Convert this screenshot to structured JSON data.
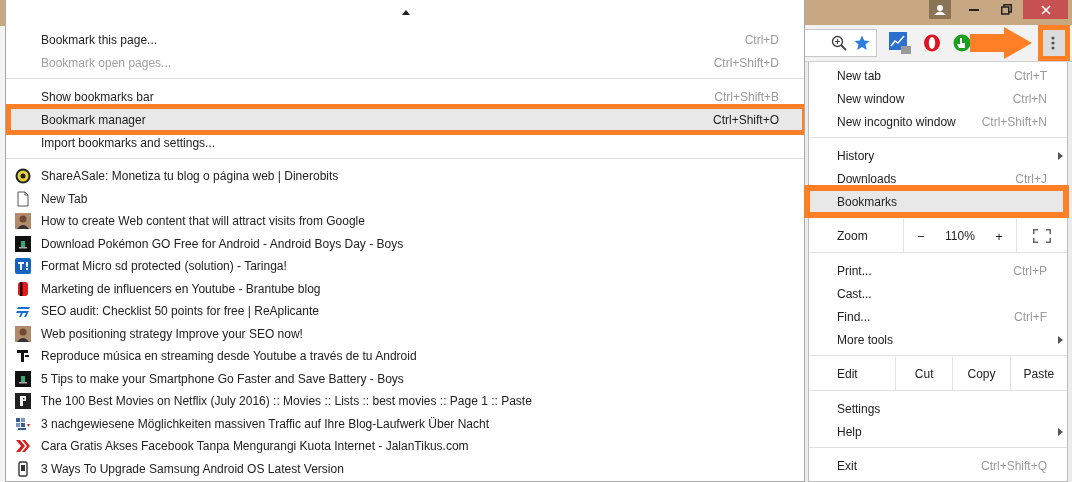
{
  "toolbar": {
    "menu_button": {
      "outlined": true,
      "pointer_arrow": true
    }
  },
  "bookmarks_menu": {
    "sections": [
      [
        {
          "label": "Bookmark this page...",
          "shortcut": "Ctrl+D",
          "disabled": false,
          "selected": false,
          "outlined": false
        },
        {
          "label": "Bookmark open pages...",
          "shortcut": "Ctrl+Shift+D",
          "disabled": true,
          "selected": false,
          "outlined": false
        }
      ],
      [
        {
          "label": "Show bookmarks bar",
          "shortcut": "Ctrl+Shift+B",
          "disabled": false,
          "selected": false,
          "outlined": false
        },
        {
          "label": "Bookmark manager",
          "shortcut": "Ctrl+Shift+O",
          "disabled": false,
          "selected": true,
          "outlined": true
        },
        {
          "label": "Import bookmarks and settings...",
          "disabled": false,
          "selected": false,
          "outlined": false
        }
      ]
    ],
    "bookmarks": [
      {
        "kind": "coin",
        "title": "ShareASale: Monetiza tu blog o página web | Dinerobits"
      },
      {
        "kind": "page",
        "title": "New Tab"
      },
      {
        "kind": "photo",
        "title": "How to create Web content that will attract visits from Google"
      },
      {
        "kind": "dark",
        "title": "Download Pokémon GO Free for Android - Android Boys Day - Boys"
      },
      {
        "kind": "blue-square",
        "title": "Format Micro sd protected (solution) - Taringa!"
      },
      {
        "kind": "red-block",
        "title": "Marketing de influencers en Youtube - Brantube blog"
      },
      {
        "kind": "stripes",
        "title": "SEO audit: Checklist 50 points for free | ReAplicante"
      },
      {
        "kind": "photo",
        "title": "Web positioning strategy Improve your SEO now!"
      },
      {
        "kind": "bars",
        "title": "Reproduce música en streaming desde Youtube a través de tu Android"
      },
      {
        "kind": "dark",
        "title": "5 Tips to make your Smartphone Go Faster and Save Battery - Boys"
      },
      {
        "kind": "black-square",
        "title": "The 100 Best Movies on Netflix (July 2016) :: Movies :: Lists :: best movies :: Page 1 :: Paste"
      },
      {
        "kind": "grid",
        "title": "3 nachgewiesene Möglichkeiten massiven Traffic auf Ihre Blog-Laufwerk Über Nacht"
      },
      {
        "kind": "chevrons",
        "title": "Cara Gratis Akses Facebook Tanpa Mengurangi Kuota Internet - JalanTikus.com"
      },
      {
        "kind": "phone",
        "title": "3 Ways To Upgrade Samsung Android OS Latest Version"
      }
    ]
  },
  "chrome_menu": {
    "sections": [
      [
        {
          "kind": "item",
          "label": "New tab",
          "shortcut": "Ctrl+T",
          "submenu": false,
          "selected": false,
          "outlined": false
        },
        {
          "kind": "item",
          "label": "New window",
          "shortcut": "Ctrl+N",
          "submenu": false,
          "selected": false,
          "outlined": false
        },
        {
          "kind": "item",
          "label": "New incognito window",
          "shortcut": "Ctrl+Shift+N",
          "submenu": false,
          "selected": false,
          "outlined": false
        }
      ],
      [
        {
          "kind": "item",
          "label": "History",
          "submenu": true,
          "selected": false,
          "outlined": false
        },
        {
          "kind": "item",
          "label": "Downloads",
          "shortcut": "Ctrl+J",
          "submenu": false,
          "selected": false,
          "outlined": false
        },
        {
          "kind": "item",
          "label": "Bookmarks",
          "submenu": false,
          "selected": true,
          "outlined": true
        }
      ],
      [
        {
          "kind": "zoom",
          "label": "Zoom",
          "minus": "−",
          "value": "110%",
          "plus": "+",
          "selected": false,
          "outlined": false
        }
      ],
      [
        {
          "kind": "item",
          "label": "Print...",
          "shortcut": "Ctrl+P",
          "submenu": false,
          "selected": false,
          "outlined": false
        },
        {
          "kind": "item",
          "label": "Cast...",
          "submenu": false,
          "selected": false,
          "outlined": false
        },
        {
          "kind": "item",
          "label": "Find...",
          "shortcut": "Ctrl+F",
          "submenu": false,
          "selected": false,
          "outlined": false
        },
        {
          "kind": "item",
          "label": "More tools",
          "submenu": true,
          "selected": false,
          "outlined": false
        }
      ],
      [
        {
          "kind": "edit",
          "label": "Edit",
          "actions": [
            "Cut",
            "Copy",
            "Paste"
          ],
          "selected": false,
          "outlined": false
        }
      ],
      [
        {
          "kind": "item",
          "label": "Settings",
          "submenu": false,
          "selected": false,
          "outlined": false
        },
        {
          "kind": "item",
          "label": "Help",
          "submenu": true,
          "selected": false,
          "outlined": false
        }
      ],
      [
        {
          "kind": "item",
          "label": "Exit",
          "shortcut": "Ctrl+Shift+Q",
          "submenu": false,
          "selected": false,
          "outlined": false
        }
      ]
    ]
  }
}
